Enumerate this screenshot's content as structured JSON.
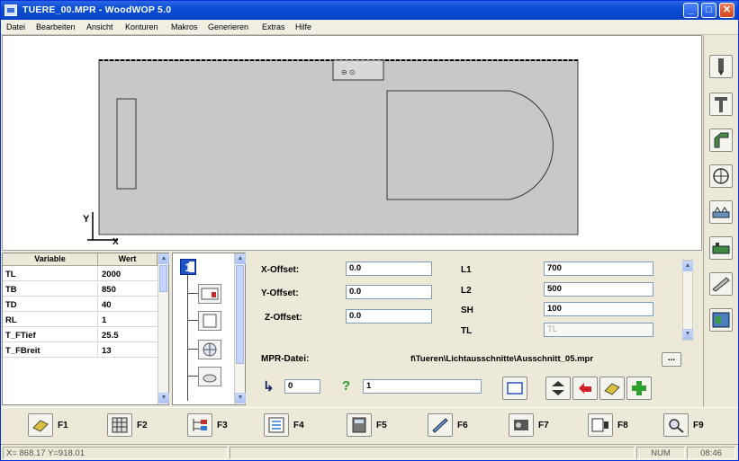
{
  "window": {
    "title": "TUERE_00.MPR - WoodWOP 5.0",
    "minimize_glyph": "_",
    "maximize_glyph": "□",
    "close_glyph": "✕"
  },
  "menu": [
    "Datei",
    "Bearbeiten",
    "Ansicht",
    "Konturen",
    "Makros",
    "Generieren",
    "Extras",
    "Hilfe"
  ],
  "canvas": {
    "axis_y": "Y",
    "axis_x": "X"
  },
  "right_toolbar": [
    "drill-bit-icon",
    "saw-blade-icon",
    "router-angle-icon",
    "circle-pattern-icon",
    "panel-icon",
    "part-machining-icon",
    "knife-icon",
    "tool-table-icon"
  ],
  "variables": {
    "header_name": "Variable",
    "header_value": "Wert",
    "rows": [
      {
        "name": "TL",
        "value": "2000"
      },
      {
        "name": "TB",
        "value": "850"
      },
      {
        "name": "TD",
        "value": "40"
      },
      {
        "name": "RL",
        "value": "1"
      },
      {
        "name": "T_FTief",
        "value": "25.5"
      },
      {
        "name": "T_FBreit",
        "value": "13"
      }
    ]
  },
  "tree": {
    "first_label": "1"
  },
  "params": {
    "x_offset_label": "X-Offset:",
    "x_offset_value": "0.0",
    "y_offset_label": "Y-Offset:",
    "y_offset_value": "0.0",
    "z_offset_label": "Z-Offset:",
    "z_offset_value": "0.0",
    "l1_label": "L1",
    "l1_value": "700",
    "l2_label": "L2",
    "l2_value": "500",
    "sh_label": "SH",
    "sh_value": "100",
    "tl_label": "TL",
    "tl_value": "TL",
    "mpr_label": "MPR-Datei:",
    "mpr_path": "f\\Tueren\\Lichtausschnitte\\Ausschnitt_05.mpr",
    "browse_label": "...",
    "step_value": "0",
    "question_value": "1"
  },
  "fkeys": [
    "F1",
    "F2",
    "F3",
    "F4",
    "F5",
    "F6",
    "F7",
    "F8",
    "F9"
  ],
  "status": {
    "coords": "X= 868.17   Y=918.01",
    "num": "NUM",
    "time": "08:46"
  }
}
